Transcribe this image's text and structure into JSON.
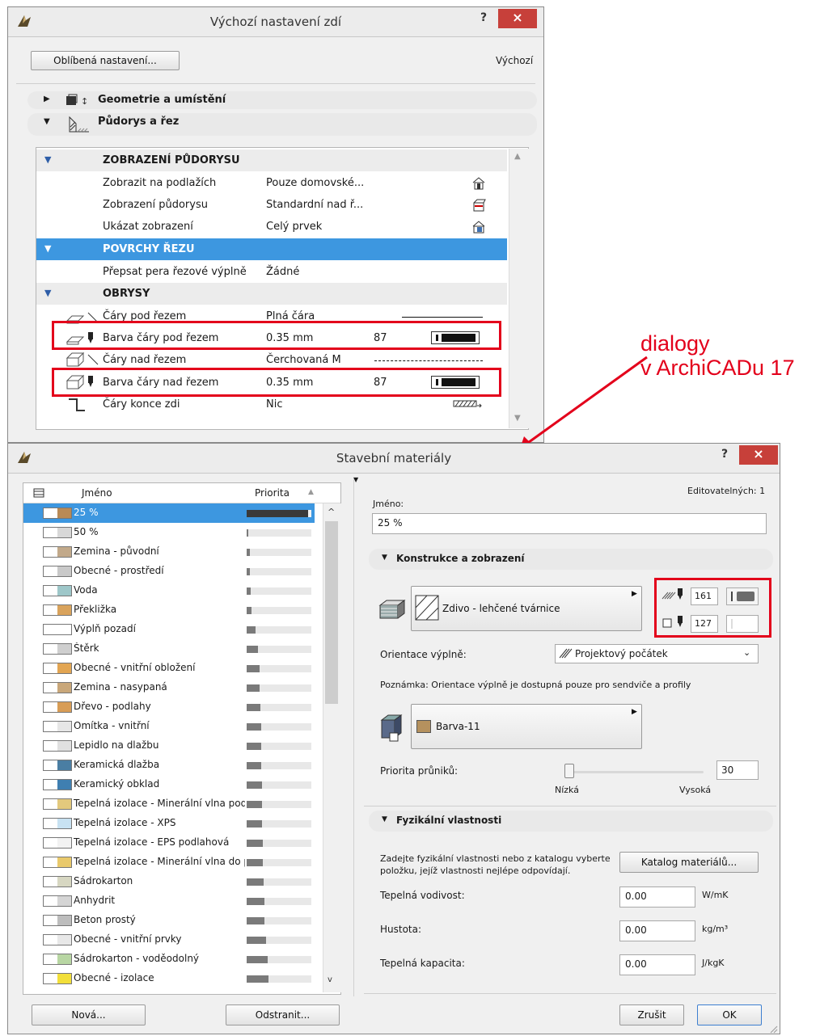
{
  "wall_dialog": {
    "title": "Výchozí nastavení zdí",
    "help": "?",
    "close": "×",
    "favorites_button": "Oblíbená nastavení...",
    "default_label": "Výchozí",
    "sections": [
      {
        "label": "Geometrie a umístění",
        "expanded": false
      },
      {
        "label": "Půdorys a řez",
        "expanded": true
      }
    ],
    "groups": {
      "floor_plan_display": "ZOBRAZENÍ PŮDORYSU",
      "cut_surfaces": "POVRCHY ŘEZU",
      "outlines": "OBRYSY"
    },
    "rows": [
      {
        "name": "Zobrazit na podlažích",
        "value": "Pouze domovské..."
      },
      {
        "name": "Zobrazení půdorysu",
        "value": "Standardní nad ř..."
      },
      {
        "name": "Ukázat zobrazení",
        "value": "Celý prvek"
      },
      {
        "name": "Přepsat pera řezové výplně",
        "value": "Žádné"
      },
      {
        "name": "Čáry pod řezem",
        "value": "Plná čára"
      },
      {
        "name": "Barva čáry pod řezem",
        "value": "0.35 mm",
        "pen": "87"
      },
      {
        "name": "Čáry nad řezem",
        "value": "Čerchovaná M"
      },
      {
        "name": "Barva čáry nad řezem",
        "value": "0.35 mm",
        "pen": "87"
      },
      {
        "name": "Čáry konce zdi",
        "value": "Nic"
      }
    ]
  },
  "annotation": {
    "line1": "dialogy",
    "line2": "v ArchiCADu 17",
    "color": "#e3001b"
  },
  "materials_dialog": {
    "title": "Stavební materiály",
    "help": "?",
    "close": "×",
    "list_header": {
      "name": "Jméno",
      "priority": "Priorita"
    },
    "materials": [
      {
        "name": "25 %",
        "priority": 0.95,
        "swatch": "#b98a56",
        "selected": true
      },
      {
        "name": "50 %",
        "priority": 0.03,
        "swatch": "#d8d8d8"
      },
      {
        "name": "Zemina - původní",
        "priority": 0.05,
        "swatch": "#c2a98a"
      },
      {
        "name": "Obecné - prostředí",
        "priority": 0.05,
        "swatch": "#c9c9c9"
      },
      {
        "name": "Voda",
        "priority": 0.06,
        "swatch": "#9ec7c9"
      },
      {
        "name": "Překližka",
        "priority": 0.08,
        "swatch": "#d9a35c"
      },
      {
        "name": "Výplň pozadí",
        "priority": 0.14,
        "swatch": "#ffffff"
      },
      {
        "name": "Štěrk",
        "priority": 0.18,
        "swatch": "#cfcfcf"
      },
      {
        "name": "Obecné - vnitřní obložení",
        "priority": 0.2,
        "swatch": "#e2a552"
      },
      {
        "name": "Zemina - nasypaná",
        "priority": 0.2,
        "swatch": "#c9a77a"
      },
      {
        "name": "Dřevo - podlahy",
        "priority": 0.21,
        "swatch": "#d89d56"
      },
      {
        "name": "Omítka - vnitřní",
        "priority": 0.22,
        "swatch": "#e6e6e6"
      },
      {
        "name": "Lepidlo na dlažbu",
        "priority": 0.23,
        "swatch": "#e0e0e0"
      },
      {
        "name": "Keramická dlažba",
        "priority": 0.23,
        "swatch": "#4a7ea3"
      },
      {
        "name": "Keramický obklad",
        "priority": 0.24,
        "swatch": "#3f7fb1"
      },
      {
        "name": "Tepelná izolace - Minerální vlna podla",
        "priority": 0.24,
        "swatch": "#e3c97d"
      },
      {
        "name": "Tepelná izolace - XPS",
        "priority": 0.24,
        "swatch": "#c8e2f2"
      },
      {
        "name": "Tepelná izolace - EPS podlahová",
        "priority": 0.25,
        "swatch": "#f2f2f2"
      },
      {
        "name": "Tepelná izolace - Minerální vlna do po",
        "priority": 0.25,
        "swatch": "#e9c96b"
      },
      {
        "name": "Sádrokarton",
        "priority": 0.26,
        "swatch": "#d7d7c2"
      },
      {
        "name": "Anhydrit",
        "priority": 0.27,
        "swatch": "#d5d5d5"
      },
      {
        "name": "Beton prostý",
        "priority": 0.28,
        "swatch": "#bdbdbd"
      },
      {
        "name": "Obecné - vnitřní prvky",
        "priority": 0.3,
        "swatch": "#e8e8e8"
      },
      {
        "name": "Sádrokarton - voděodolný",
        "priority": 0.32,
        "swatch": "#b8d6a3"
      },
      {
        "name": "Obecné - izolace",
        "priority": 0.34,
        "swatch": "#f2df3a"
      }
    ],
    "new_button": "Nová...",
    "delete_button": "Odstranit...",
    "editable_label": "Editovatelných: 1",
    "name_label": "Jméno:",
    "name_value": "25 %",
    "construction_section": "Konstrukce a zobrazení",
    "fill_name": "Zdivo - lehčené tvárnice",
    "pen_fg": "161",
    "pen_bg": "127",
    "fill_orientation_label": "Orientace výplně:",
    "fill_orientation_value": "Projektový počátek",
    "note": "Poznámka: Orientace výplně je dostupná pouze pro sendviče a profily",
    "surface_name": "Barva-11",
    "surface_color": "#b5915e",
    "intersection_priority_label": "Priorita průniků:",
    "intersection_priority_value": "30",
    "priority_fraction": 0.0,
    "slider_low": "Nízká",
    "slider_high": "Vysoká",
    "physical_section": "Fyzikální vlastnosti",
    "physical_help": "Zadejte fyzikální vlastnosti nebo z katalogu vyberte položku, jejíž vlastnosti nejlépe odpovídají.",
    "catalog_button": "Katalog materiálů...",
    "properties": [
      {
        "label": "Tepelná vodivost:",
        "value": "0.00",
        "unit": "W/mK"
      },
      {
        "label": "Hustota:",
        "value": "0.00",
        "unit": "kg/m³"
      },
      {
        "label": "Tepelná kapacita:",
        "value": "0.00",
        "unit": "J/kgK"
      }
    ],
    "cancel_button": "Zrušit",
    "ok_button": "OK"
  }
}
